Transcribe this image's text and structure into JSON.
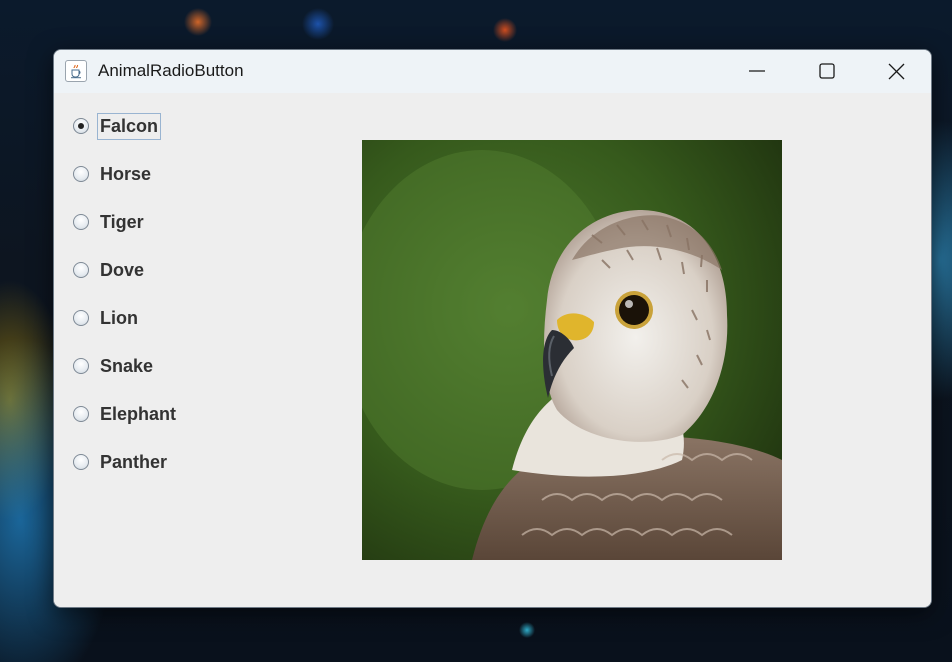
{
  "window": {
    "title": "AnimalRadioButton",
    "app_icon": "java-coffee-cup-icon",
    "controls": {
      "minimize_icon": "minimize-icon",
      "maximize_icon": "maximize-icon",
      "close_icon": "close-icon"
    }
  },
  "radio_group": {
    "selected": "Falcon",
    "options": [
      {
        "label": "Falcon",
        "checked": true
      },
      {
        "label": "Horse",
        "checked": false
      },
      {
        "label": "Tiger",
        "checked": false
      },
      {
        "label": "Dove",
        "checked": false
      },
      {
        "label": "Lion",
        "checked": false
      },
      {
        "label": "Snake",
        "checked": false
      },
      {
        "label": "Elephant",
        "checked": false
      },
      {
        "label": "Panther",
        "checked": false
      }
    ]
  },
  "image": {
    "subject": "falcon-photo"
  },
  "colors": {
    "window_bg": "#eeeeee",
    "titlebar_bg": "#eef3f7",
    "label_text": "#333333",
    "focus_ring": "#99b4d1"
  }
}
